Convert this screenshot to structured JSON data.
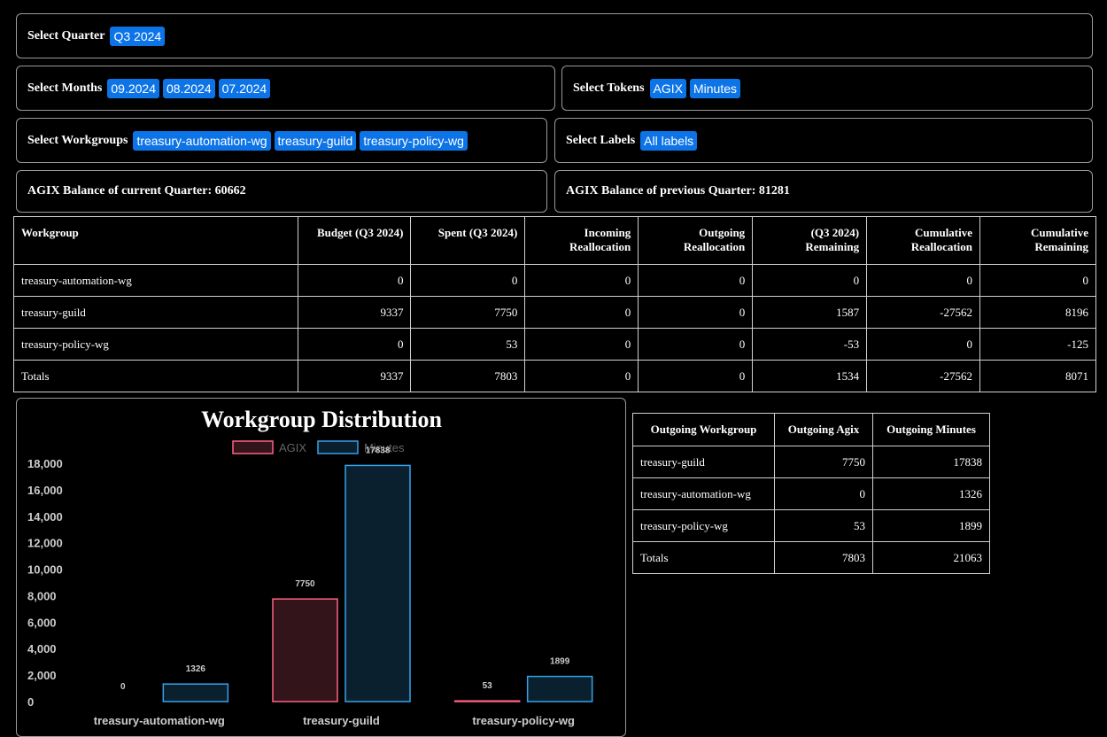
{
  "filters": {
    "quarter": {
      "label": "Select Quarter",
      "values": [
        "Q3 2024"
      ]
    },
    "months": {
      "label": "Select Months",
      "values": [
        "09.2024",
        "08.2024",
        "07.2024"
      ]
    },
    "tokens": {
      "label": "Select Tokens",
      "values": [
        "AGIX",
        "Minutes"
      ]
    },
    "workgroups": {
      "label": "Select Workgroups",
      "values": [
        "treasury-automation-wg",
        "treasury-guild",
        "treasury-policy-wg"
      ]
    },
    "labels": {
      "label": "Select Labels",
      "values": [
        "All labels"
      ]
    }
  },
  "balances": {
    "current": "AGIX Balance of current Quarter: 60662",
    "previous": "AGIX Balance of previous Quarter: 81281"
  },
  "main_table": {
    "headers": [
      "Workgroup",
      "Budget (Q3 2024)",
      "Spent (Q3 2024)",
      "Incoming Reallocation",
      "Outgoing Reallocation",
      "(Q3 2024) Remaining",
      "Cumulative Reallocation",
      "Cumulative Remaining"
    ],
    "rows": [
      [
        "treasury-automation-wg",
        "0",
        "0",
        "0",
        "0",
        "0",
        "0",
        "0"
      ],
      [
        "treasury-guild",
        "9337",
        "7750",
        "0",
        "0",
        "1587",
        "-27562",
        "8196"
      ],
      [
        "treasury-policy-wg",
        "0",
        "53",
        "0",
        "0",
        "-53",
        "0",
        "-125"
      ],
      [
        "Totals",
        "9337",
        "7803",
        "0",
        "0",
        "1534",
        "-27562",
        "8071"
      ]
    ]
  },
  "outgoing_table": {
    "headers": [
      "Outgoing Workgroup",
      "Outgoing Agix",
      "Outgoing Minutes"
    ],
    "rows": [
      [
        "treasury-guild",
        "7750",
        "17838"
      ],
      [
        "treasury-automation-wg",
        "0",
        "1326"
      ],
      [
        "treasury-policy-wg",
        "53",
        "1899"
      ],
      [
        "Totals",
        "7803",
        "21063"
      ]
    ]
  },
  "chart_data": {
    "type": "bar",
    "title": "Workgroup Distribution",
    "categories": [
      "treasury-automation-wg",
      "treasury-guild",
      "treasury-policy-wg"
    ],
    "series": [
      {
        "name": "AGIX",
        "values": [
          0,
          7750,
          53
        ],
        "color": "#ff6384"
      },
      {
        "name": "Minutes",
        "values": [
          1326,
          17838,
          1899
        ],
        "color": "#36a2eb"
      }
    ],
    "ylim": [
      0,
      18000
    ],
    "yticks": [
      "0",
      "2,000",
      "4,000",
      "6,000",
      "8,000",
      "10,000",
      "12,000",
      "14,000",
      "16,000",
      "18,000"
    ],
    "legend": "top",
    "grid": false,
    "data_labels": true
  }
}
